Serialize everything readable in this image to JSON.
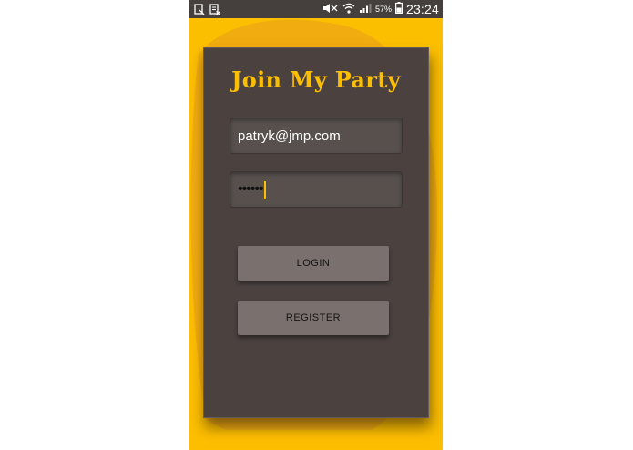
{
  "status_bar": {
    "left_icons": [
      "screenshot-icon",
      "notification-cleared-icon"
    ],
    "right_icons": [
      "mute-icon",
      "wifi-icon",
      "signal-icon"
    ],
    "battery_percent": "57%",
    "time": "23:24"
  },
  "login_card": {
    "title": "Join My Party",
    "email_value": "patryk@jmp.com",
    "password_value": "••••••",
    "login_label": "LOGIN",
    "register_label": "REGISTER"
  },
  "colors": {
    "background": "#fcbf00",
    "blob": "#f0aa12",
    "card": "#4b4240",
    "title": "#fcbf00",
    "button": "#7a706d",
    "status_bar": "#45403d"
  }
}
